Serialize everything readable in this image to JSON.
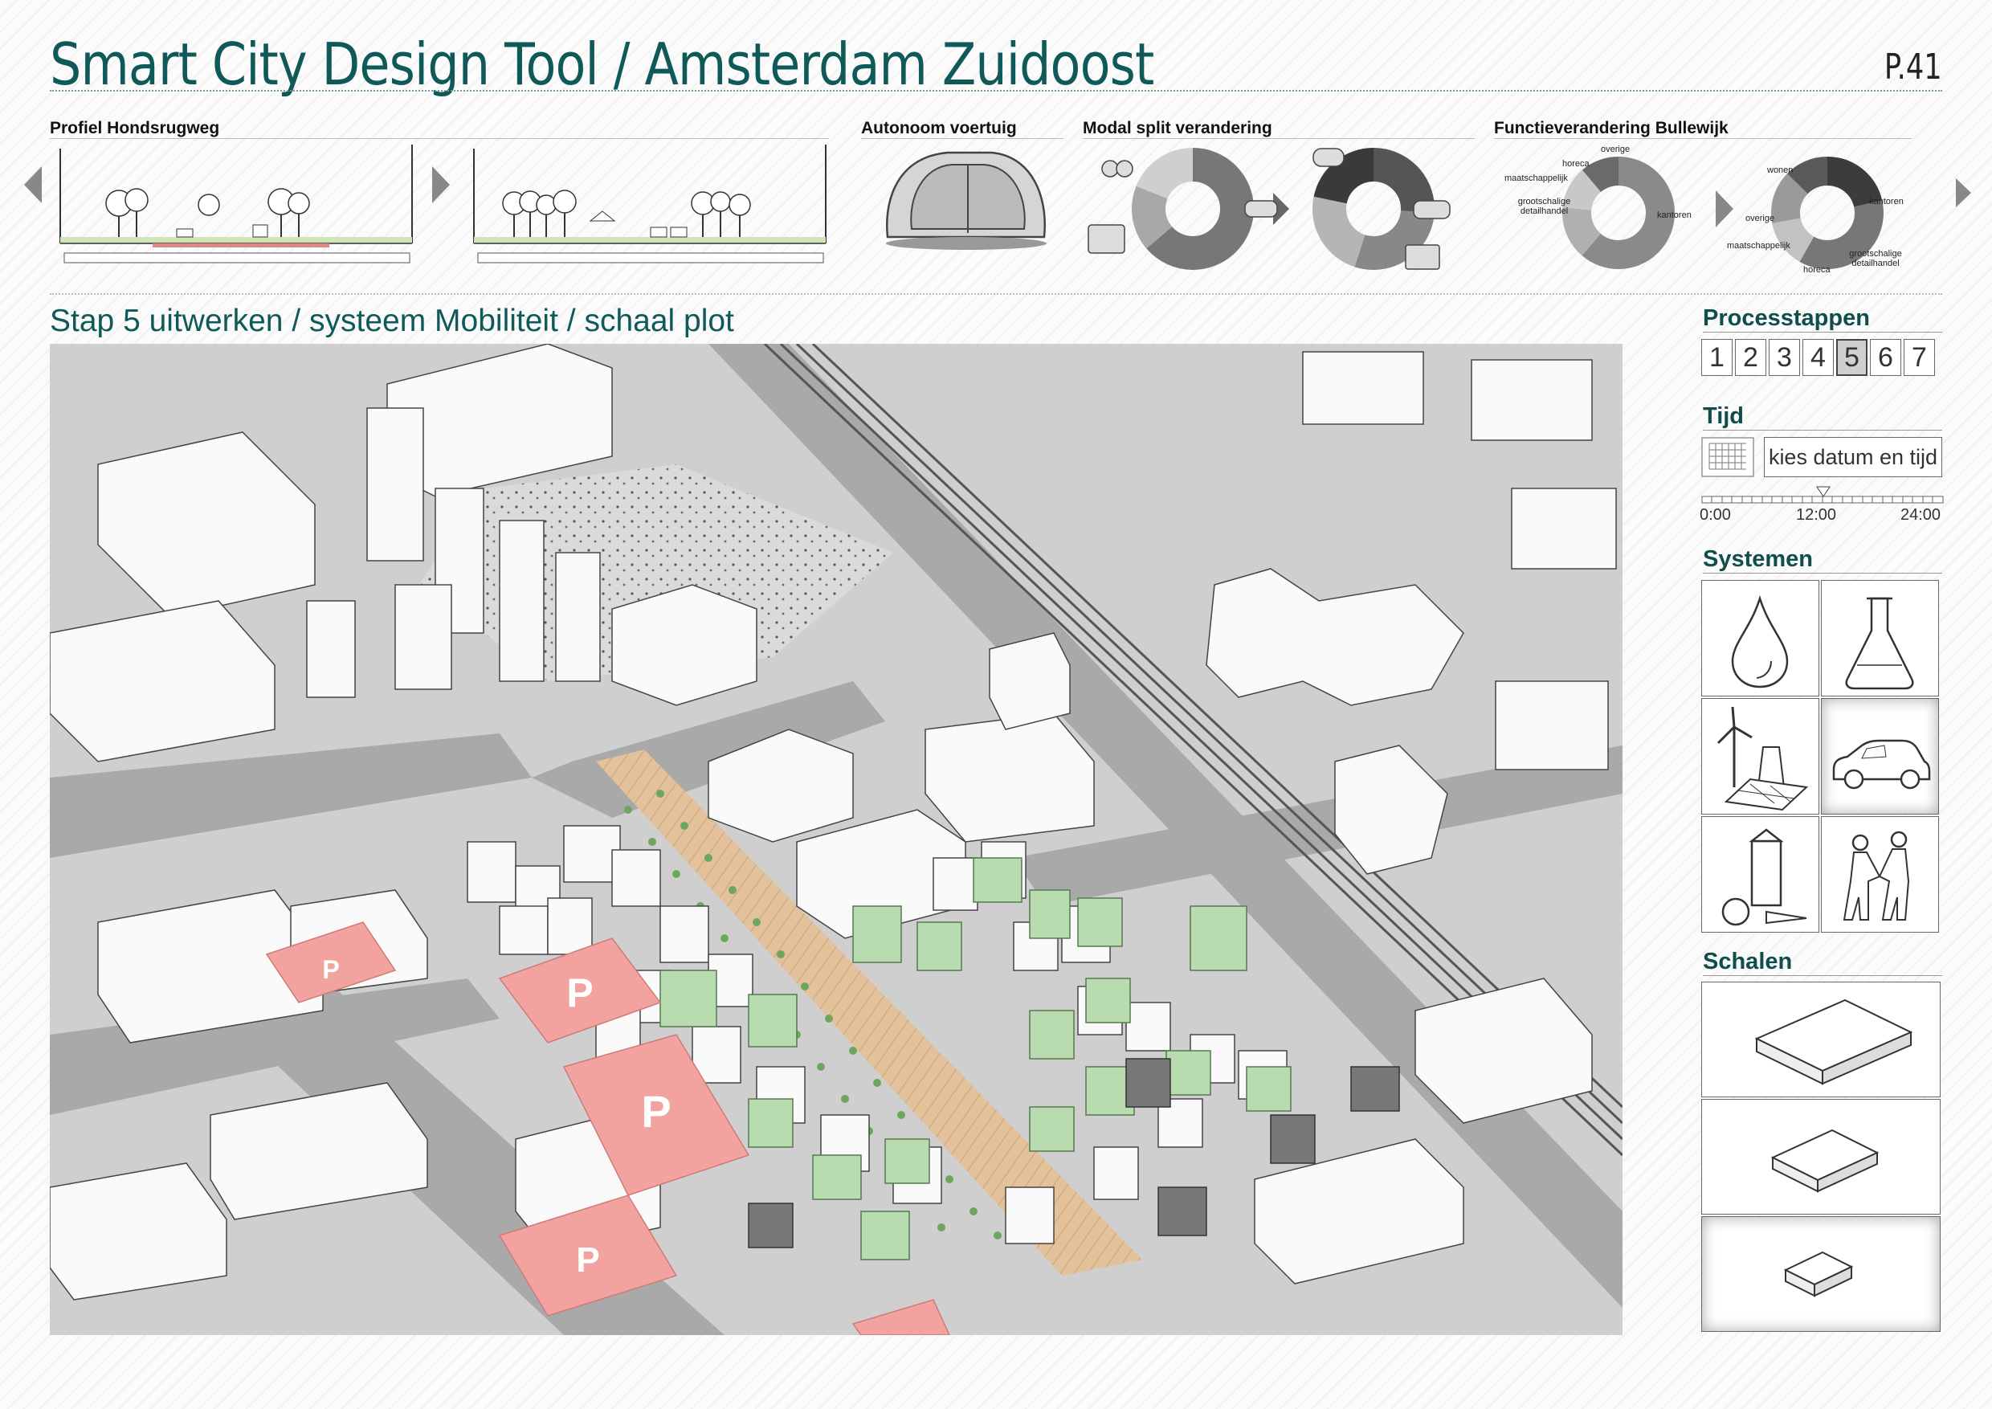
{
  "header": {
    "title": "Smart City Design Tool / Amsterdam Zuidoost",
    "page_number": "P.41"
  },
  "panels": {
    "profiel": {
      "title": "Profiel Hondsrugweg"
    },
    "autonoom": {
      "title": "Autonoom voertuig"
    },
    "modal": {
      "title": "Modal split verandering"
    },
    "functie": {
      "title": "Functieverandering Bullewijk",
      "before_labels": [
        "overige",
        "horeca",
        "maatschappelijk",
        "grootschalige detailhandel",
        "kantoren"
      ],
      "after_labels": [
        "wonen",
        "kantoren",
        "overige",
        "maatschappelijk",
        "horeca",
        "grootschalige detailhandel"
      ]
    }
  },
  "main": {
    "subtitle": "Stap 5 uitwerken / systeem Mobiliteit / schaal plot",
    "map_icon": "isometric-urban-plan-map",
    "parking_label": "P"
  },
  "sidebar": {
    "processtappen": {
      "title": "Processtappen",
      "steps": [
        "1",
        "2",
        "3",
        "4",
        "5",
        "6",
        "7"
      ],
      "active": "5"
    },
    "tijd": {
      "title": "Tijd",
      "date_button": "kies datum en tijd",
      "calendar_icon": "calendar-grid-icon",
      "ticks": [
        "0:00",
        "12:00",
        "24:00"
      ],
      "slider_value": "12:00"
    },
    "systemen": {
      "title": "Systemen",
      "items": [
        "water-drop-icon",
        "flask-icon",
        "energy-icon",
        "car-icon",
        "food-icon",
        "people-handshake-icon"
      ],
      "active": "car-icon"
    },
    "schalen": {
      "title": "Schalen",
      "items": [
        "scale-large-icon",
        "scale-medium-icon",
        "scale-small-icon"
      ],
      "active": "scale-small-icon"
    }
  },
  "colors": {
    "accent": "#0f5a58",
    "parking": "#f2a3a0",
    "boulevard": "#e2c19b",
    "green_building": "#b9dbb0"
  }
}
